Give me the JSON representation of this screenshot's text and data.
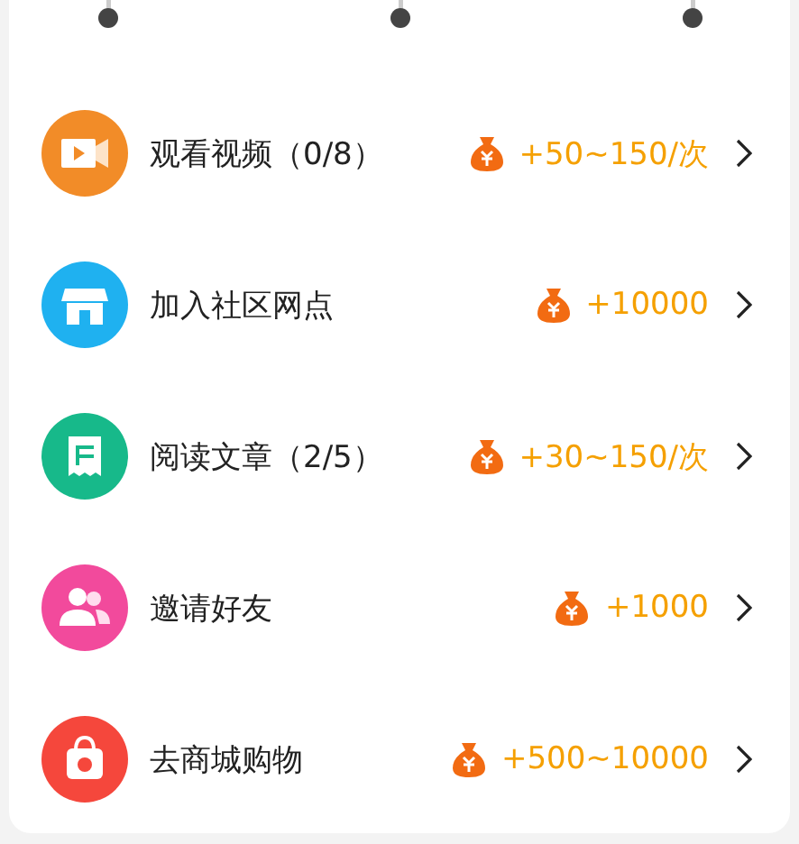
{
  "tasks": [
    {
      "kind": "video",
      "title": "观看视频（0/8）",
      "reward": "+50~150/次"
    },
    {
      "kind": "shop",
      "title": "加入社区网点",
      "reward": "+10000"
    },
    {
      "kind": "article",
      "title": "阅读文章（2/5）",
      "reward": "+30~150/次"
    },
    {
      "kind": "friends",
      "title": "邀请好友",
      "reward": "+1000"
    },
    {
      "kind": "mall",
      "title": "去商城购物",
      "reward": "+500~10000"
    }
  ]
}
